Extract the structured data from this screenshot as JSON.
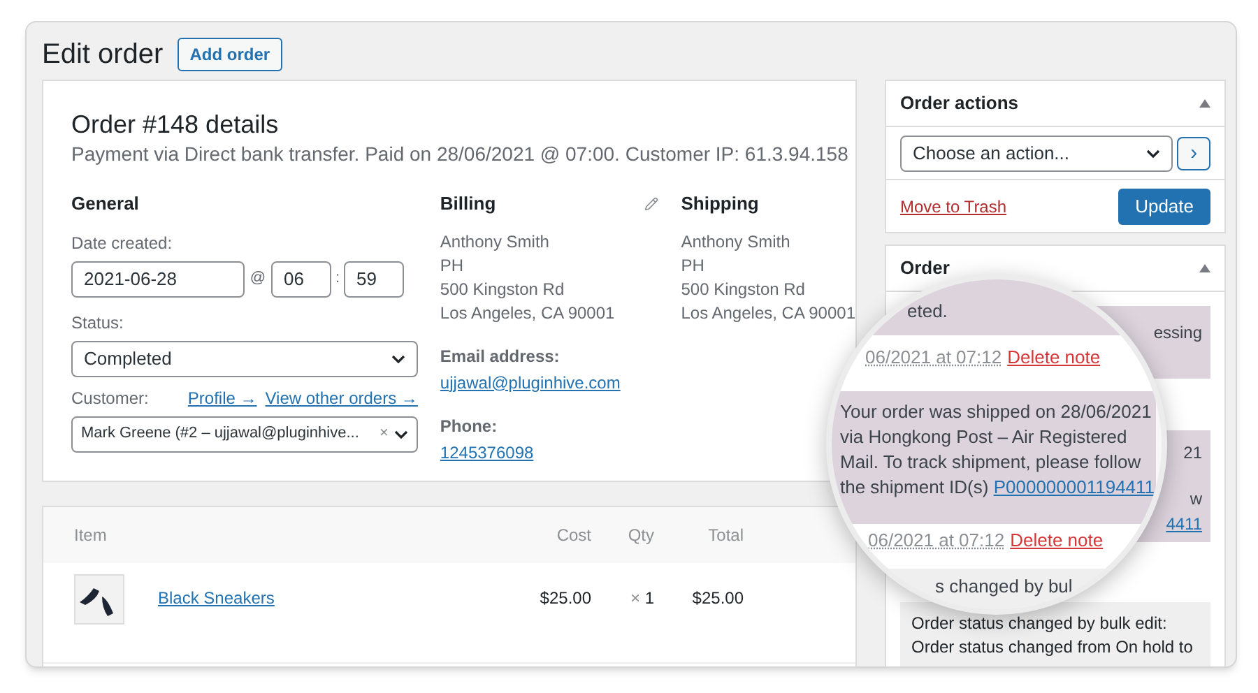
{
  "page_title": "Edit order",
  "add_button": "Add order",
  "order_details": {
    "title": "Order #148 details",
    "subtitle": "Payment via Direct bank transfer. Paid on 28/06/2021 @ 07:00. Customer IP: 61.3.94.158",
    "general": {
      "heading": "General",
      "date_label": "Date created:",
      "date": "2021-06-28",
      "at": "@",
      "hour": "06",
      "colon": ":",
      "minute": "59",
      "status_label": "Status:",
      "status": "Completed",
      "customer_label": "Customer:",
      "links": [
        "Profile →",
        "View other orders →"
      ],
      "customer": "Mark Greene (#2 – ujjawal@pluginhive...",
      "clear": "×"
    },
    "billing": {
      "heading": "Billing",
      "address": [
        "Anthony Smith",
        "PH",
        "500 Kingston Rd",
        "Los Angeles, CA 90001"
      ],
      "email_label": "Email address:",
      "email": "ujjawal@pluginhive.com",
      "phone_label": "Phone:",
      "phone": "1245376098"
    },
    "shipping": {
      "heading": "Shipping",
      "address": [
        "Anthony Smith",
        "PH",
        "500 Kingston Rd",
        "Los Angeles, CA 90001"
      ]
    }
  },
  "items": {
    "columns": [
      "Item",
      "Cost",
      "Qty",
      "Total"
    ],
    "rows": [
      {
        "name": "Black Sneakers",
        "cost": "$25.00",
        "qty_sign": "×",
        "qty": "1",
        "total": "$25.00"
      }
    ]
  },
  "order_actions": {
    "title": "Order actions",
    "select": "Choose an action...",
    "go": "›",
    "trash": "Move to Trash",
    "update": "Update"
  },
  "order_notes": {
    "title": "Order",
    "notes": [
      {
        "kind": "customer",
        "lines": [
          "essing"
        ]
      },
      {
        "kind": "customer",
        "lines": [
          "21",
          "w"
        ],
        "link": "4411"
      },
      {
        "kind": "system",
        "lines": [
          "Order status changed by bulk edit:",
          "Order status changed from On hold to"
        ]
      }
    ]
  },
  "magnifier": {
    "notes": [
      {
        "kind": "customer",
        "text": "eted.",
        "date": "06/2021 at 07:12",
        "delete": "Delete note"
      },
      {
        "kind": "customer",
        "text": "Your order was shipped on 28/06/2021 via Hongkong Post – Air Registered Mail. To track shipment, please follow the shipment ID(s)",
        "link": "P000000001194411",
        "date": "06/2021 at 07:12",
        "delete": "Delete note"
      },
      {
        "kind": "system",
        "text": "s changed by bul"
      }
    ]
  }
}
